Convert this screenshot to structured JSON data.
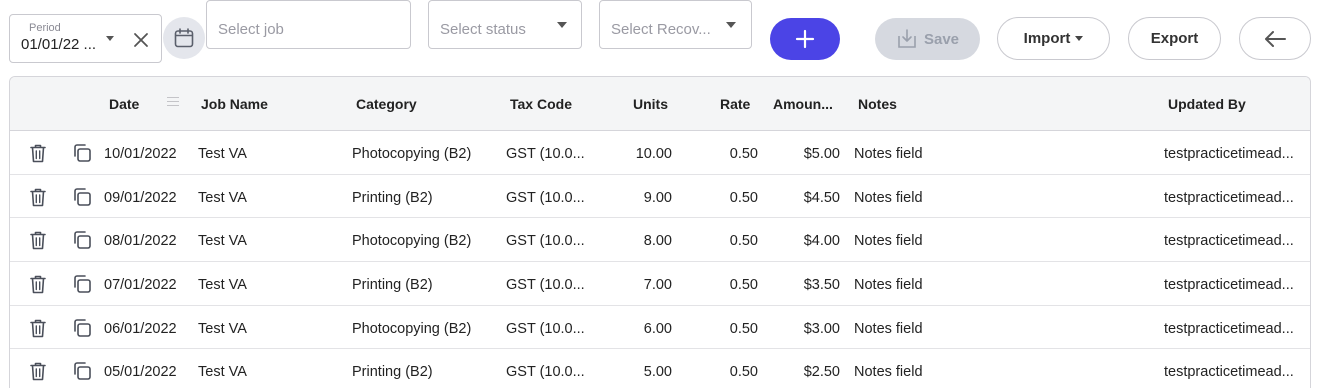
{
  "toolbar": {
    "period": {
      "legend": "Period",
      "value": "01/01/22 ..."
    },
    "job": {
      "placeholder": "Select job"
    },
    "status": {
      "placeholder": "Select status"
    },
    "recov": {
      "placeholder": "Select Recov..."
    },
    "save_label": "Save",
    "import_label": "Import",
    "export_label": "Export"
  },
  "colors": {
    "accent": "#4b44e6",
    "disabled": "#d6d9e0",
    "header_bg": "#f4f5f6"
  },
  "table": {
    "columns": [
      "Date",
      "Job Name",
      "Category",
      "Tax Code",
      "Units",
      "Rate",
      "Amoun...",
      "Notes",
      "Updated By"
    ],
    "rows": [
      {
        "date": "10/01/2022",
        "job": "Test VA",
        "category": "Photocopying (B2)",
        "tax": "GST (10.0...",
        "units": "10.00",
        "rate": "0.50",
        "amount": "$5.00",
        "notes": "Notes field",
        "updated": "testpracticetimead..."
      },
      {
        "date": "09/01/2022",
        "job": "Test VA",
        "category": "Printing (B2)",
        "tax": "GST (10.0...",
        "units": "9.00",
        "rate": "0.50",
        "amount": "$4.50",
        "notes": "Notes field",
        "updated": "testpracticetimead..."
      },
      {
        "date": "08/01/2022",
        "job": "Test VA",
        "category": "Photocopying (B2)",
        "tax": "GST (10.0...",
        "units": "8.00",
        "rate": "0.50",
        "amount": "$4.00",
        "notes": "Notes field",
        "updated": "testpracticetimead..."
      },
      {
        "date": "07/01/2022",
        "job": "Test VA",
        "category": "Printing (B2)",
        "tax": "GST (10.0...",
        "units": "7.00",
        "rate": "0.50",
        "amount": "$3.50",
        "notes": "Notes field",
        "updated": "testpracticetimead..."
      },
      {
        "date": "06/01/2022",
        "job": "Test VA",
        "category": "Photocopying (B2)",
        "tax": "GST (10.0...",
        "units": "6.00",
        "rate": "0.50",
        "amount": "$3.00",
        "notes": "Notes field",
        "updated": "testpracticetimead..."
      },
      {
        "date": "05/01/2022",
        "job": "Test VA",
        "category": "Printing (B2)",
        "tax": "GST (10.0...",
        "units": "5.00",
        "rate": "0.50",
        "amount": "$2.50",
        "notes": "Notes field",
        "updated": "testpracticetimead..."
      }
    ]
  }
}
